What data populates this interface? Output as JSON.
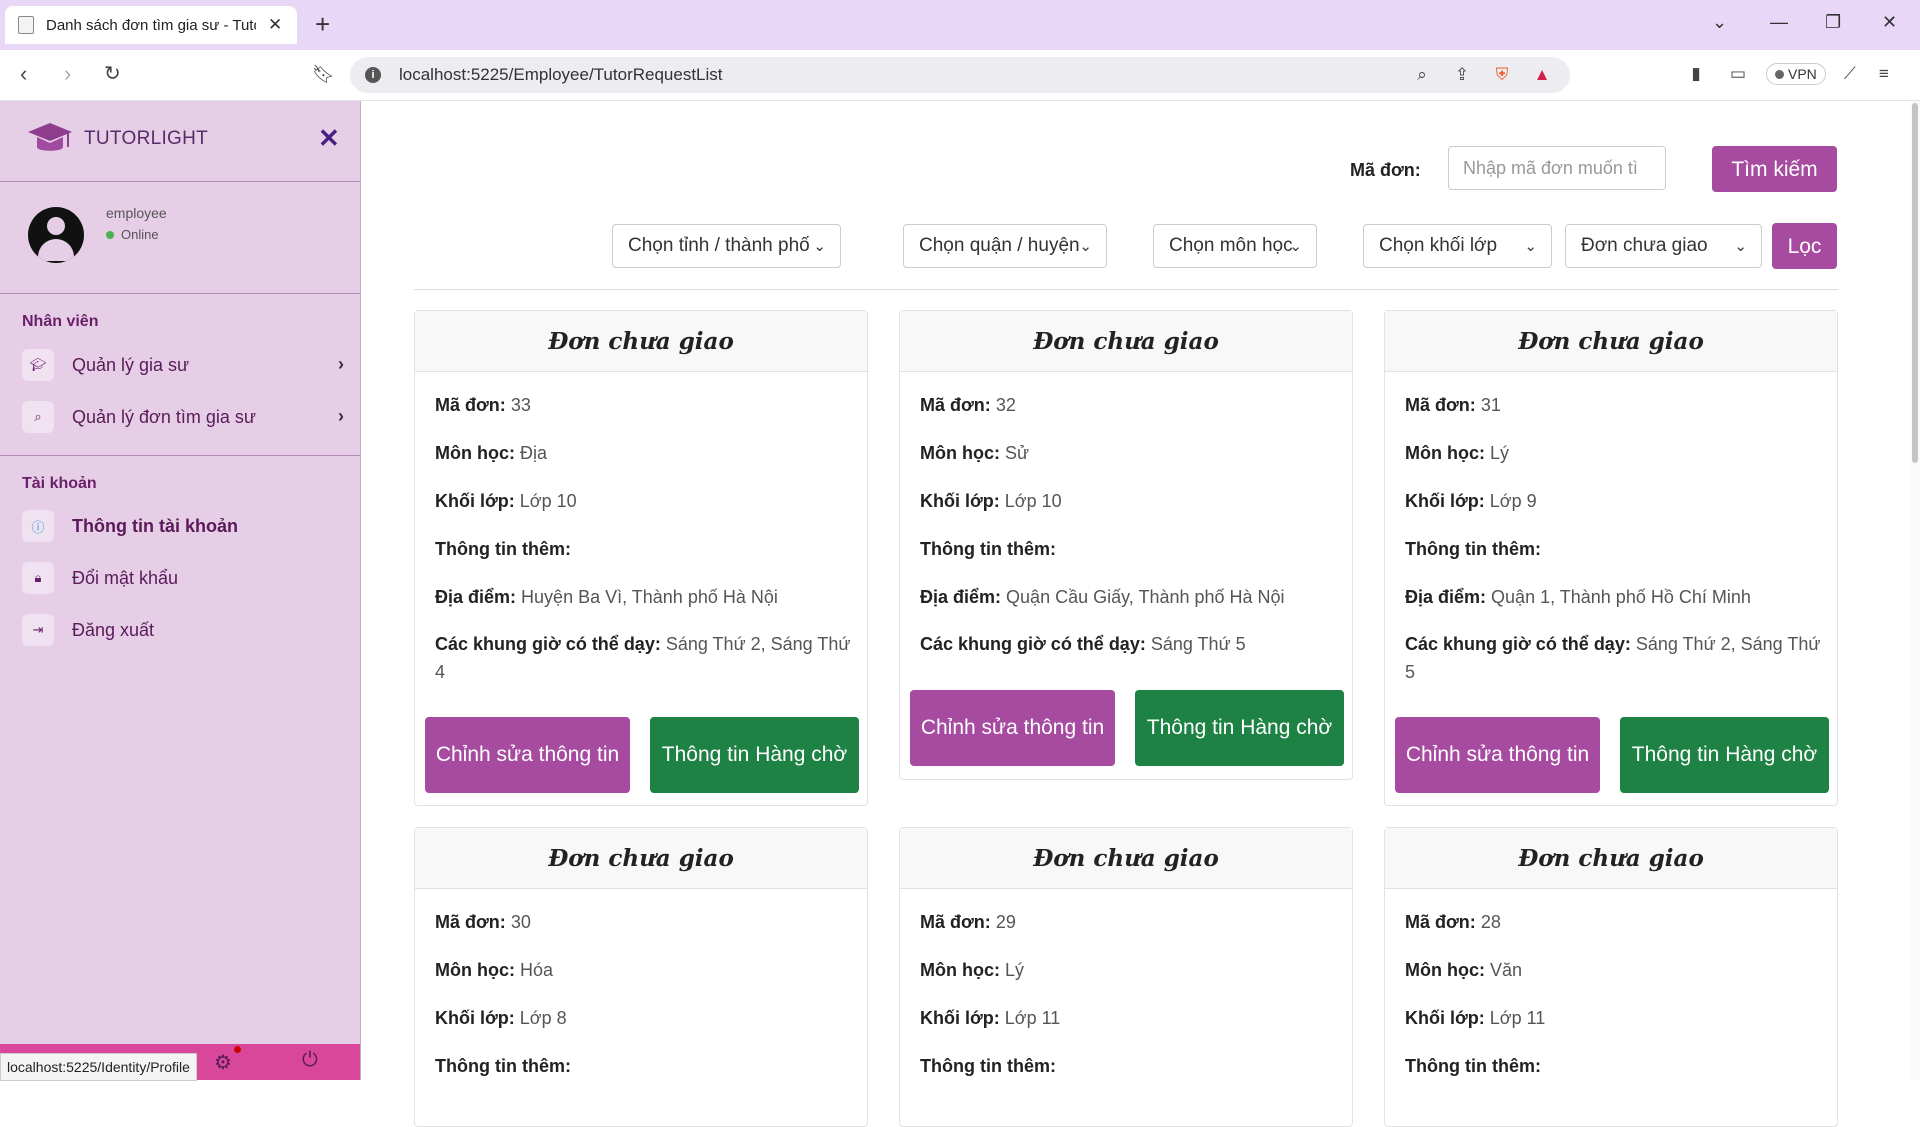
{
  "browser": {
    "tab_title": "Danh sách đơn tìm gia sư - Tuto",
    "url": "localhost:5225/Employee/TutorRequestList",
    "vpn_label": "VPN",
    "status_url": "localhost:5225/Identity/Profile"
  },
  "sidebar": {
    "brand": "TUTORLIGHT",
    "user": {
      "name": "employee",
      "status": "Online"
    },
    "sections": [
      {
        "title": "Nhân viên",
        "items": [
          {
            "label": "Quản lý gia sư",
            "icon": "graduation-cap-icon"
          },
          {
            "label": "Quản lý đơn tìm gia sư",
            "icon": "search-icon"
          }
        ]
      },
      {
        "title": "Tài khoản",
        "items": [
          {
            "label": "Thông tin tài khoản",
            "icon": "info-icon"
          },
          {
            "label": "Đổi mật khẩu",
            "icon": "lock-icon"
          },
          {
            "label": "Đăng xuất",
            "icon": "sign-out-icon"
          }
        ]
      }
    ]
  },
  "search": {
    "label": "Mã đơn:",
    "placeholder": "Nhập mã đơn muốn tì",
    "button": "Tìm kiếm"
  },
  "filters": {
    "city": "Chọn tỉnh / thành phố",
    "district": "Chọn quận / huyện",
    "subject": "Chọn môn học",
    "grade": "Chọn khối lớp",
    "status": "Đơn chưa giao",
    "button": "Lọc"
  },
  "labels": {
    "id": "Mã đơn:",
    "subject": "Môn học:",
    "grade": "Khối lớp:",
    "extra": "Thông tin thêm:",
    "location": "Địa điểm:",
    "times": "Các khung giờ có thể dạy:",
    "edit_button": "Chỉnh sửa thông tin",
    "queue_button": "Thông tin Hàng chờ"
  },
  "cards": [
    {
      "header": "Đơn chưa giao",
      "id": "33",
      "subject": "Địa",
      "grade": "Lớp 10",
      "location": "Huyện Ba Vì, Thành phố Hà Nội",
      "times": "Sáng Thứ 2, Sáng Thứ 4"
    },
    {
      "header": "Đơn chưa giao",
      "id": "32",
      "subject": "Sử",
      "grade": "Lớp 10",
      "location": "Quận Cầu Giấy, Thành phố Hà Nội",
      "times": "Sáng Thứ 5"
    },
    {
      "header": "Đơn chưa giao",
      "id": "31",
      "subject": "Lý",
      "grade": "Lớp 9",
      "location": "Quận 1, Thành phố Hồ Chí Minh",
      "times": "Sáng Thứ 2, Sáng Thứ 5"
    },
    {
      "header": "Đơn chưa giao",
      "id": "30",
      "subject": "Hóa",
      "grade": "Lớp 8"
    },
    {
      "header": "Đơn chưa giao",
      "id": "29",
      "subject": "Lý",
      "grade": "Lớp 11"
    },
    {
      "header": "Đơn chưa giao",
      "id": "28",
      "subject": "Văn",
      "grade": "Lớp 11"
    }
  ]
}
